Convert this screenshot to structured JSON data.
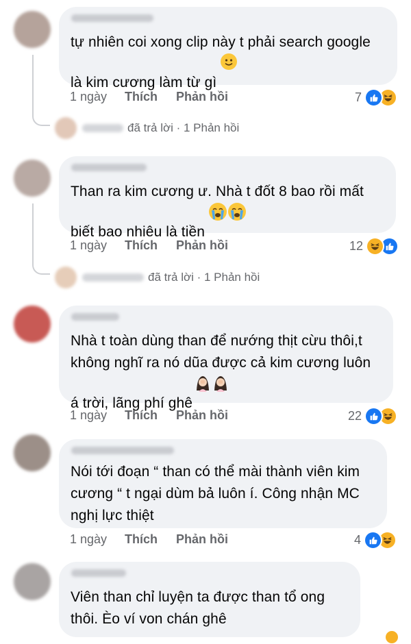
{
  "comments": [
    {
      "text": "tự nhiên coi xong clip này t phải search google\nlà kim cương làm từ gì",
      "emoji": "slightly-smiling-face",
      "time": "1 ngày",
      "like": "Thích",
      "reply": "Phản hồi",
      "reaction_count": "7",
      "reactions": [
        "like-icon",
        "haha-icon"
      ],
      "reply_summary": "đã trả lời · 1 Phản hồi"
    },
    {
      "text": "Than ra kim cương ư. Nhà t đốt 8 bao rồi mất\nbiết bao nhiêu là tiền",
      "emoji": "loudly-crying-face x2",
      "time": "1 ngày",
      "like": "Thích",
      "reply": "Phản hồi",
      "reaction_count": "12",
      "reactions": [
        "haha-icon",
        "like-icon"
      ],
      "reply_summary": "đã trả lời · 1 Phản hồi"
    },
    {
      "text": "Nhà t toàn dùng than để nướng thịt cừu thôi,t\nkhông nghĩ ra nó dũa được cả kim cương luôn\ná trời, lãng phí ghê",
      "emoji": "woman-facepalming x2",
      "time": "1 ngày",
      "like": "Thích",
      "reply": "Phản hồi",
      "reaction_count": "22",
      "reactions": [
        "like-icon",
        "haha-icon"
      ]
    },
    {
      "text": "Nói tới đoạn “ than có thể mài thành viên kim\ncương “ t ngại dùm bả luôn í. Công nhận MC\nnghị lực thiệt",
      "time": "1 ngày",
      "like": "Thích",
      "reply": "Phản hồi",
      "reaction_count": "4",
      "reactions": [
        "like-icon",
        "haha-icon"
      ]
    },
    {
      "text": "Viên  than  chỉ luyện ta được  than  tổ ong\nthôi. Èo  ví von  chán  ghê"
    }
  ],
  "colors": {
    "bubble": "#f0f2f5",
    "meta_text": "#65676b",
    "like_blue": "#1877f2",
    "haha_yellow": "#f7b125"
  }
}
